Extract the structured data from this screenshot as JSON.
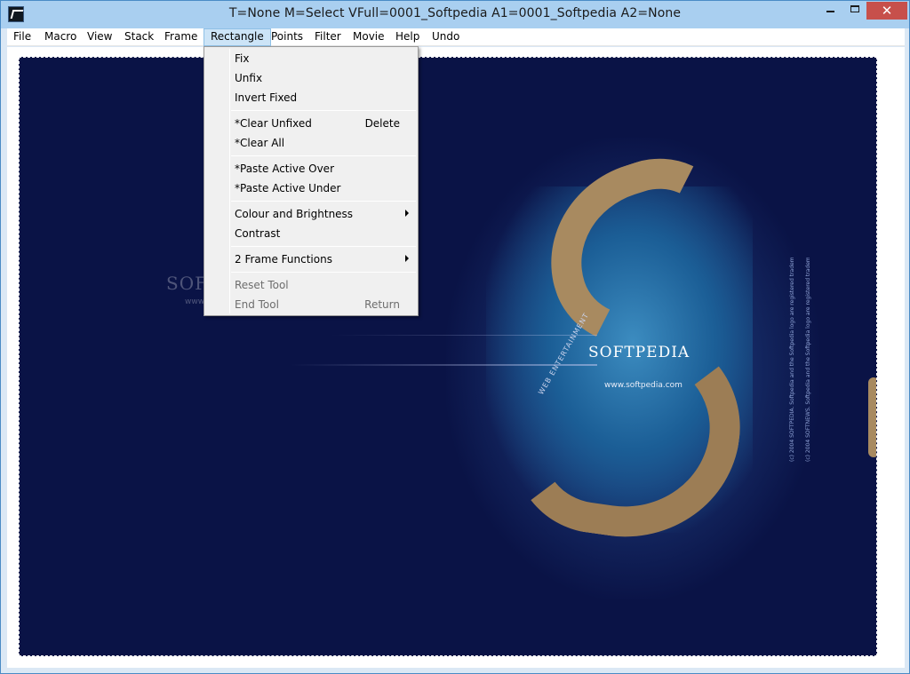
{
  "window": {
    "title": "T=None M=Select VFull=0001_Softpedia  A1=0001_Softpedia  A2=None",
    "controls": {
      "minimize": "minimize",
      "maximize": "maximize",
      "close": "✕"
    }
  },
  "menubar": {
    "items": [
      "File",
      "Macro",
      "View",
      "Stack",
      "Frame",
      "Rectangle",
      "Points",
      "Filter",
      "Movie",
      "Help",
      "Undo"
    ],
    "active": "Rectangle"
  },
  "dropdown": {
    "menu": "Rectangle",
    "items": [
      {
        "label": "Fix",
        "shortcut": "",
        "submenu": false,
        "enabled": true
      },
      {
        "label": "Unfix",
        "shortcut": "",
        "submenu": false,
        "enabled": true
      },
      {
        "label": "Invert Fixed",
        "shortcut": "",
        "submenu": false,
        "enabled": true
      },
      {
        "label": "*Clear Unfixed",
        "shortcut": "Delete",
        "submenu": false,
        "enabled": true
      },
      {
        "label": "*Clear All",
        "shortcut": "",
        "submenu": false,
        "enabled": true
      },
      {
        "label": "*Paste Active Over",
        "shortcut": "",
        "submenu": false,
        "enabled": true
      },
      {
        "label": "*Paste Active Under",
        "shortcut": "",
        "submenu": false,
        "enabled": true
      },
      {
        "label": "Colour and Brightness",
        "shortcut": "",
        "submenu": true,
        "enabled": true
      },
      {
        "label": "Contrast",
        "shortcut": "",
        "submenu": false,
        "enabled": true
      },
      {
        "label": "2 Frame Functions",
        "shortcut": "",
        "submenu": true,
        "enabled": true
      },
      {
        "label": "Reset Tool",
        "shortcut": "",
        "submenu": false,
        "enabled": false
      },
      {
        "label": "End Tool",
        "shortcut": "Return",
        "submenu": false,
        "enabled": false
      }
    ]
  },
  "image": {
    "logo": "SOFTPEDIA",
    "url": "www.softpedia.com",
    "tagline": "WEB ENTERTAINMENT",
    "watermark": "SOFTPEDIA",
    "watermark_url": "www.softpedia.com",
    "copyright_line1": "(c) 2004 SOFTPEDIA. Softpedia and the Softpedia logo are registered trademarks.",
    "copyright_line2": "(c) 2004 SOFTNEWS. Softpedia and the Softpedia logo are registered trademarks."
  },
  "colors": {
    "title_bar": "#a9cff0",
    "close_button": "#c7504b",
    "menu_highlight": "#cce4f7",
    "image_background": "#0a1346"
  },
  "icons": {
    "app": "app-icon"
  }
}
